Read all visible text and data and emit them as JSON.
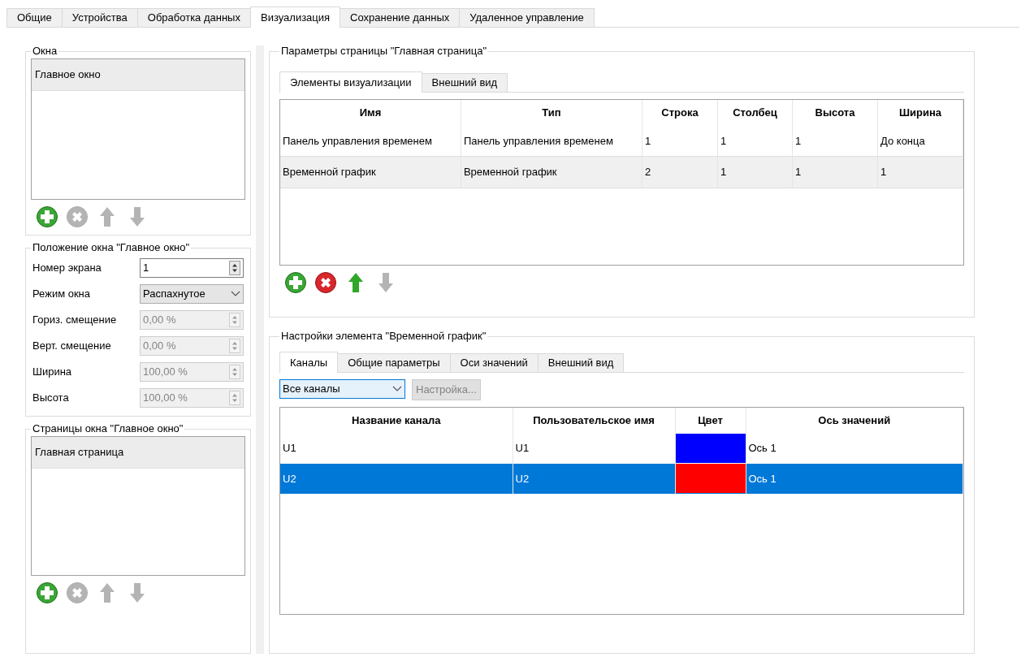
{
  "tabs": [
    {
      "label": "Общие",
      "selected": false
    },
    {
      "label": "Устройства",
      "selected": false
    },
    {
      "label": "Обработка данных",
      "selected": false
    },
    {
      "label": "Визуализация",
      "selected": true
    },
    {
      "label": "Сохранение данных",
      "selected": false
    },
    {
      "label": "Удаленное управление",
      "selected": false
    }
  ],
  "windows_group": {
    "title": "Окна",
    "items": [
      {
        "label": "Главное окно",
        "selected": true
      }
    ],
    "toolbar": [
      {
        "kind": "add",
        "disabled": false
      },
      {
        "kind": "remove",
        "disabled": true
      },
      {
        "kind": "up",
        "disabled": true
      },
      {
        "kind": "down",
        "disabled": true
      }
    ]
  },
  "position_group": {
    "title": "Положение окна \"Главное окно\"",
    "fields": [
      {
        "label": "Номер экрана",
        "kind": "spin",
        "value": "1",
        "disabled": false
      },
      {
        "label": "Режим окна",
        "kind": "combo",
        "value": "Распахнутое",
        "disabled": false
      },
      {
        "label": "Гориз. смещение",
        "kind": "spin",
        "value": "0,00 %",
        "disabled": true
      },
      {
        "label": "Верт. смещение",
        "kind": "spin",
        "value": "0,00 %",
        "disabled": true
      },
      {
        "label": "Ширина",
        "kind": "spin",
        "value": "100,00 %",
        "disabled": true
      },
      {
        "label": "Высота",
        "kind": "spin",
        "value": "100,00 %",
        "disabled": true
      }
    ]
  },
  "pages_group": {
    "title": "Страницы окна \"Главное окно\"",
    "items": [
      {
        "label": "Главная страница",
        "selected": true
      }
    ],
    "toolbar": [
      {
        "kind": "add",
        "disabled": false
      },
      {
        "kind": "remove",
        "disabled": true
      },
      {
        "kind": "up",
        "disabled": true
      },
      {
        "kind": "down",
        "disabled": true
      }
    ]
  },
  "page_params": {
    "title": "Параметры страницы \"Главная страница\"",
    "tabs": [
      {
        "label": "Элементы визуализации",
        "selected": true
      },
      {
        "label": "Внешний вид",
        "selected": false
      }
    ],
    "table": {
      "columns": [
        "Имя",
        "Тип",
        "Строка",
        "Столбец",
        "Высота",
        "Ширина"
      ],
      "rows": [
        {
          "cells": [
            "Панель управления временем",
            "Панель управления временем",
            "1",
            "1",
            "1",
            "До конца"
          ],
          "selected": false
        },
        {
          "cells": [
            "Временной график",
            "Временной график",
            "2",
            "1",
            "1",
            "1"
          ],
          "selected": true
        }
      ]
    },
    "toolbar": [
      {
        "kind": "add",
        "disabled": false
      },
      {
        "kind": "remove",
        "disabled": false
      },
      {
        "kind": "up",
        "disabled": false
      },
      {
        "kind": "down",
        "disabled": true
      }
    ]
  },
  "element_settings": {
    "title": "Настройки элемента \"Временной график\"",
    "tabs": [
      {
        "label": "Каналы",
        "selected": true
      },
      {
        "label": "Общие параметры",
        "selected": false
      },
      {
        "label": "Оси значений",
        "selected": false
      },
      {
        "label": "Внешний вид",
        "selected": false
      }
    ],
    "filter": {
      "value": "Все каналы"
    },
    "setup_button": {
      "label": "Настройка...",
      "disabled": true
    },
    "table": {
      "columns": [
        "Название канала",
        "Пользовательское имя",
        "Цвет",
        "Ось значений"
      ],
      "rows": [
        {
          "name": "U1",
          "user_name": "U1",
          "color": "#0000ff",
          "axis": "Ось 1",
          "selected": false
        },
        {
          "name": "U2",
          "user_name": "U2",
          "color": "#ff0000",
          "axis": "Ось 1",
          "selected": true
        }
      ]
    }
  }
}
